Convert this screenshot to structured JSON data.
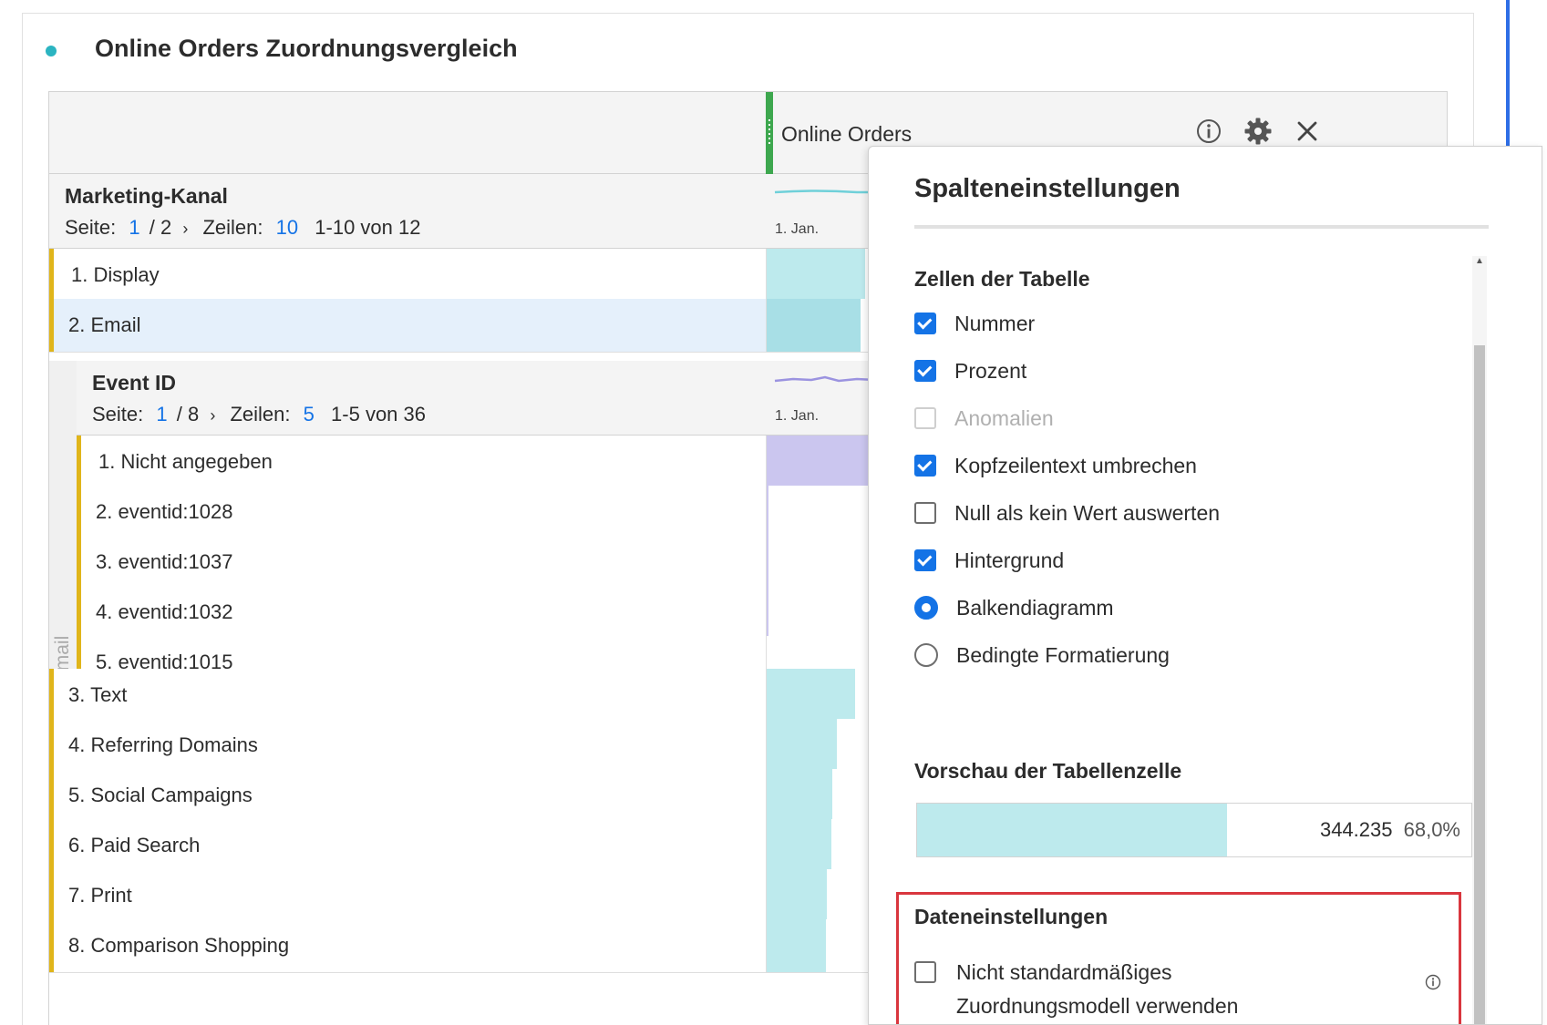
{
  "panel": {
    "title": "Online Orders Zuordnungsvergleich",
    "dot_color": "#2bb4c1"
  },
  "table": {
    "metric_title": "Online Orders",
    "header_icons": [
      "info-icon",
      "gear-icon",
      "close-icon"
    ],
    "marketing": {
      "title": "Marketing-Kanal",
      "page_label": "Seite:",
      "page_current": "1",
      "page_total": "/ 2",
      "rows_label": "Zeilen:",
      "rows_value": "10",
      "range": "1-10 von 12",
      "spark_date": "1. Jan."
    },
    "rows_top": [
      {
        "label": "1. Display",
        "fill": 0.9,
        "color": "#bdeaed"
      },
      {
        "label": "2. Email",
        "fill": 0.86,
        "color": "#a8dfe6"
      }
    ],
    "event": {
      "title": "Event ID",
      "page_label": "Seite:",
      "page_current": "1",
      "page_total": "/ 8",
      "rows_label": "Zeilen:",
      "rows_value": "5",
      "range": "1-5 von 36",
      "spark_date": "1. Jan.",
      "nest_label": "Email"
    },
    "event_rows": [
      {
        "label": "1. Nicht angegeben",
        "fill": 1.0,
        "color": "#cbc6ef"
      },
      {
        "label": "2. eventid:1028",
        "fill": 0.02,
        "color": "#cbc6ef"
      },
      {
        "label": "3. eventid:1037",
        "fill": 0.02,
        "color": "#cbc6ef"
      },
      {
        "label": "4. eventid:1032",
        "fill": 0.02,
        "color": "#cbc6ef"
      },
      {
        "label": "5. eventid:1015",
        "fill": 0.0,
        "color": "#cbc6ef"
      }
    ],
    "rows_bottom": [
      {
        "label": "3. Text",
        "fill": 0.81,
        "color": "#bdeaed"
      },
      {
        "label": "4. Referring Domains",
        "fill": 0.64,
        "color": "#bdeaed"
      },
      {
        "label": "5. Social Campaigns",
        "fill": 0.6,
        "color": "#bdeaed"
      },
      {
        "label": "6. Paid Search",
        "fill": 0.59,
        "color": "#bdeaed"
      },
      {
        "label": "7. Print",
        "fill": 0.55,
        "color": "#bdeaed"
      },
      {
        "label": "8. Comparison Shopping",
        "fill": 0.54,
        "color": "#bdeaed"
      }
    ]
  },
  "settings": {
    "title": "Spalteneinstellungen",
    "cells_heading": "Zellen der Tabelle",
    "options": [
      {
        "label": "Nummer",
        "kind": "checkbox",
        "checked": true,
        "disabled": false
      },
      {
        "label": "Prozent",
        "kind": "checkbox",
        "checked": true,
        "disabled": false
      },
      {
        "label": "Anomalien",
        "kind": "checkbox",
        "checked": false,
        "disabled": true
      },
      {
        "label": "Kopfzeilentext umbrechen",
        "kind": "checkbox",
        "checked": true,
        "disabled": false
      },
      {
        "label": "Null als kein Wert auswerten",
        "kind": "checkbox",
        "checked": false,
        "disabled": false
      },
      {
        "label": "Hintergrund",
        "kind": "checkbox",
        "checked": true,
        "disabled": false
      },
      {
        "label": "Balkendiagramm",
        "kind": "radio",
        "checked": true,
        "disabled": false
      },
      {
        "label": "Bedingte Formatierung",
        "kind": "radio",
        "checked": false,
        "disabled": false
      }
    ],
    "preview_heading": "Vorschau der Tabellenzelle",
    "preview_value": "344.235",
    "preview_percent": "68,0%",
    "preview_fill": 0.68,
    "data_heading": "Dateneinstellungen",
    "data_option": "Nicht standardmäßiges Zuordnungsmodell verwenden",
    "data_option_checked": false
  }
}
